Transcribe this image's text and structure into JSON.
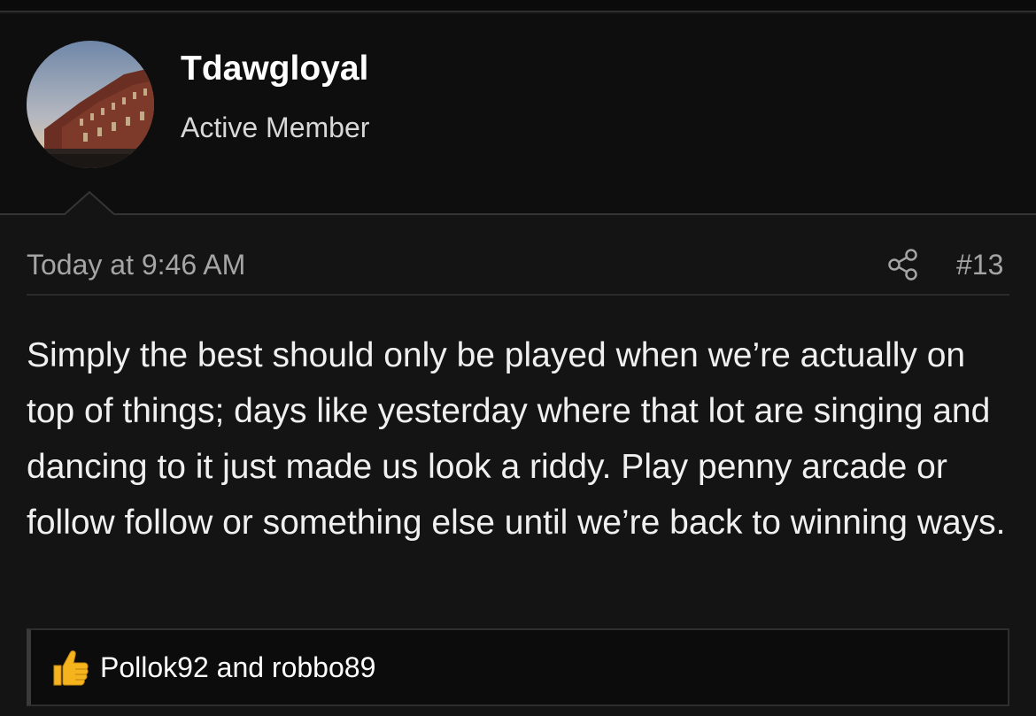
{
  "post": {
    "author": {
      "username": "Tdawgloyal",
      "title": "Active Member"
    },
    "date": "Today at 9:46 AM",
    "number": "#13",
    "body": "Simply the best should only be played when we’re actually on top of things; days like yesterday where that lot are singing and dancing to it just made us look a riddy. Play penny arcade or follow follow or something else until we’re back to winning ways.",
    "reactions": {
      "text": "Pollok92 and robbo89",
      "icon": "thumbs-up-icon"
    },
    "share_icon": "share-icon"
  },
  "colors": {
    "background": "#141414",
    "header_background": "#0e0e0e",
    "text": "#f0f0f0",
    "muted": "#a5a5a5",
    "thumb": "#f5b41e"
  }
}
